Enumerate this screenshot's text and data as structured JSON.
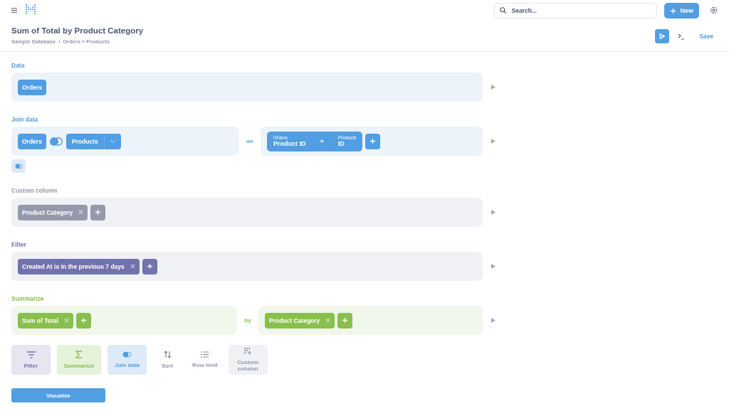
{
  "top_bar": {
    "search": {
      "placeholder": "Search..."
    },
    "new_button": "New"
  },
  "header": {
    "title": "Sum of Total by Product Category",
    "breadcrumb": [
      "Sample Database",
      "Orders + Products"
    ],
    "breadcrumb_separator": "/",
    "save": "Save"
  },
  "steps": [
    {
      "kind": "data",
      "label": "Data",
      "pills": [
        {
          "text": "Orders",
          "removable": false
        }
      ]
    },
    {
      "kind": "join",
      "label": "Join data",
      "left_table": "Orders",
      "right_table": "Products",
      "on_label": "on",
      "condition": {
        "left_table": "Orders",
        "left_field": "Product ID",
        "operator": "=",
        "right_table": "Products",
        "right_field": "ID"
      }
    },
    {
      "kind": "custom_column",
      "label": "Custom column",
      "pills": [
        {
          "text": "Product Category",
          "removable": true
        }
      ]
    },
    {
      "kind": "filter",
      "label": "Filter",
      "pills": [
        {
          "text": "Created At is in the previous 7 days",
          "removable": true
        }
      ]
    },
    {
      "kind": "summarize",
      "label": "Summarize",
      "pills": [
        {
          "text": "Sum of Total",
          "removable": true
        }
      ],
      "by_label": "by",
      "groups": [
        {
          "text": "Product Category",
          "removable": true
        }
      ]
    }
  ],
  "actions": [
    {
      "kind": "filter",
      "label": "Filter"
    },
    {
      "kind": "summarize",
      "label": "Summarize"
    },
    {
      "kind": "join",
      "label": "Join data"
    },
    {
      "kind": "sort",
      "label": "Sort"
    },
    {
      "kind": "limit",
      "label": "Row limit"
    },
    {
      "kind": "custom_column",
      "label": "Custom column"
    }
  ],
  "visualize": "Visualize"
}
